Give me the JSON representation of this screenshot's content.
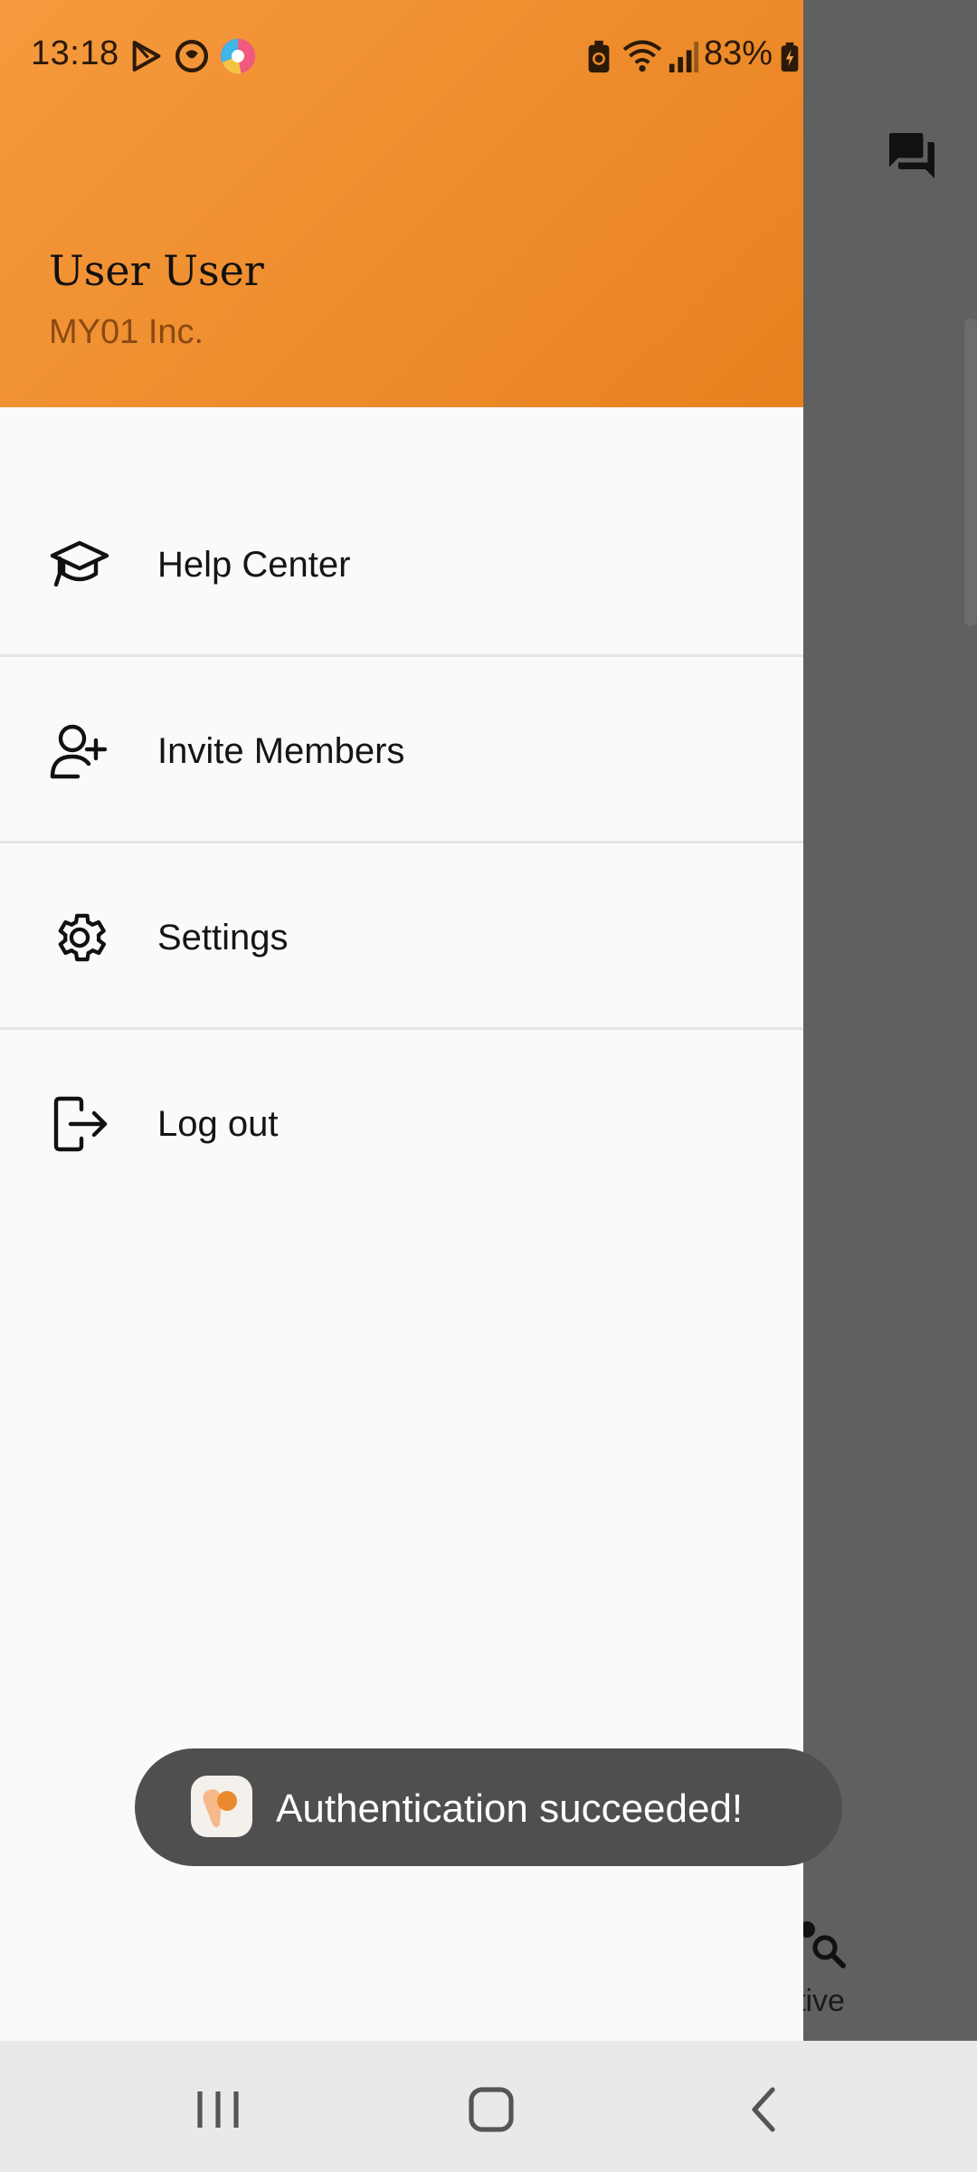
{
  "status_bar": {
    "time": "13:18",
    "battery_percent": "83%",
    "icons": [
      "play-store-icon",
      "music-icon",
      "browser-icon",
      "battery-saver-icon",
      "wifi-icon",
      "signal-icon",
      "battery-charging-icon"
    ]
  },
  "drawer": {
    "user_name": "User User",
    "org_name": "MY01 Inc.",
    "items": [
      {
        "label": "Help Center",
        "icon": "graduation-cap-icon"
      },
      {
        "label": "Invite Members",
        "icon": "add-user-icon"
      },
      {
        "label": "Settings",
        "icon": "gear-icon"
      },
      {
        "label": "Log out",
        "icon": "logout-icon"
      }
    ]
  },
  "background": {
    "tab_label": "ctive",
    "icons": [
      "chat-icon",
      "user-search-icon"
    ]
  },
  "toast": {
    "message": "Authentication succeeded!"
  },
  "colors": {
    "header_start": "#f59a3e",
    "header_end": "#e8811e",
    "scrim": "#5f5f5f",
    "toast_bg": "#4f4f4f"
  }
}
